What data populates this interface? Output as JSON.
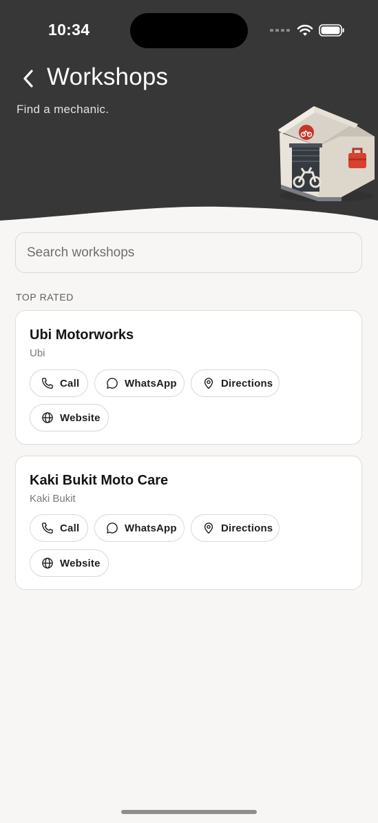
{
  "status_bar": {
    "time": "10:34"
  },
  "header": {
    "title": "Workshops",
    "subtitle": "Find a mechanic.",
    "background_color": "#373737"
  },
  "search": {
    "placeholder": "Search workshops",
    "value": ""
  },
  "section": {
    "label": "TOP RATED"
  },
  "workshops": [
    {
      "name": "Ubi Motorworks",
      "location": "Ubi",
      "actions": {
        "call": "Call",
        "whatsapp": "WhatsApp",
        "directions": "Directions",
        "website": "Website"
      }
    },
    {
      "name": "Kaki Bukit Moto Care",
      "location": "Kaki Bukit",
      "actions": {
        "call": "Call",
        "whatsapp": "WhatsApp",
        "directions": "Directions",
        "website": "Website"
      }
    }
  ],
  "icons": {
    "back": "chevron-left-icon",
    "call": "phone-icon",
    "whatsapp": "chat-bubble-icon",
    "directions": "map-pin-icon",
    "website": "globe-icon",
    "illustration": "garage-motorcycle-icon"
  }
}
